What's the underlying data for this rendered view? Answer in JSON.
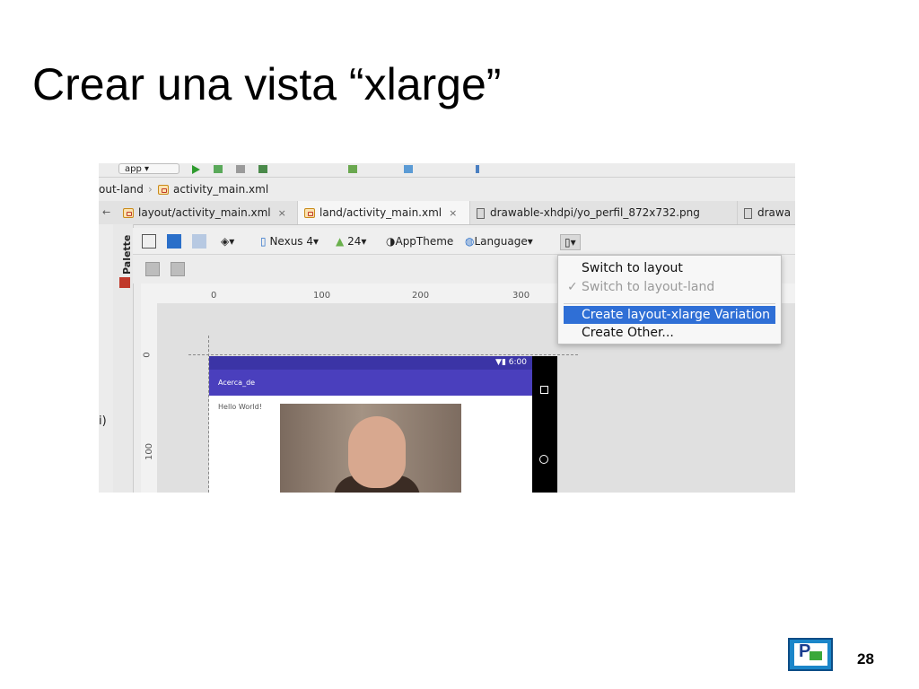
{
  "slide": {
    "title": "Crear una vista “xlarge”",
    "page_number": "28"
  },
  "ide": {
    "toolbar": {
      "app_label": "app"
    },
    "breadcrumb": [
      "out-land",
      "activity_main.xml"
    ],
    "tabs": [
      {
        "label": "layout/activity_main.xml",
        "close": "×"
      },
      {
        "label": "land/activity_main.xml",
        "close": "×"
      },
      {
        "label": "drawable-xhdpi/yo_perfil_872x732.png"
      },
      {
        "label": "drawa"
      }
    ],
    "palette_label": "Palette",
    "editor_toolbar": {
      "device": "Nexus 4",
      "api": "24",
      "theme": "AppTheme",
      "language": "Language"
    },
    "ruler": {
      "h_ticks": [
        "0",
        "100",
        "200",
        "300"
      ],
      "v_ticks": [
        "0",
        "100"
      ]
    },
    "side_text": "i)",
    "device_preview": {
      "status_time": "6:00",
      "app_title": "Acerca_de",
      "hello_text": "Hello World!"
    },
    "dropdown": {
      "items": [
        {
          "label": "Switch to layout",
          "state": "normal"
        },
        {
          "label": "Switch to layout-land",
          "state": "disabled",
          "check": "✓"
        },
        {
          "label": "Create layout-xlarge Variation",
          "state": "selected"
        },
        {
          "label": "Create Other...",
          "state": "normal"
        }
      ]
    },
    "colors": {
      "selection": "#2f6fd6",
      "app_bar": "#4a3fbd"
    }
  }
}
